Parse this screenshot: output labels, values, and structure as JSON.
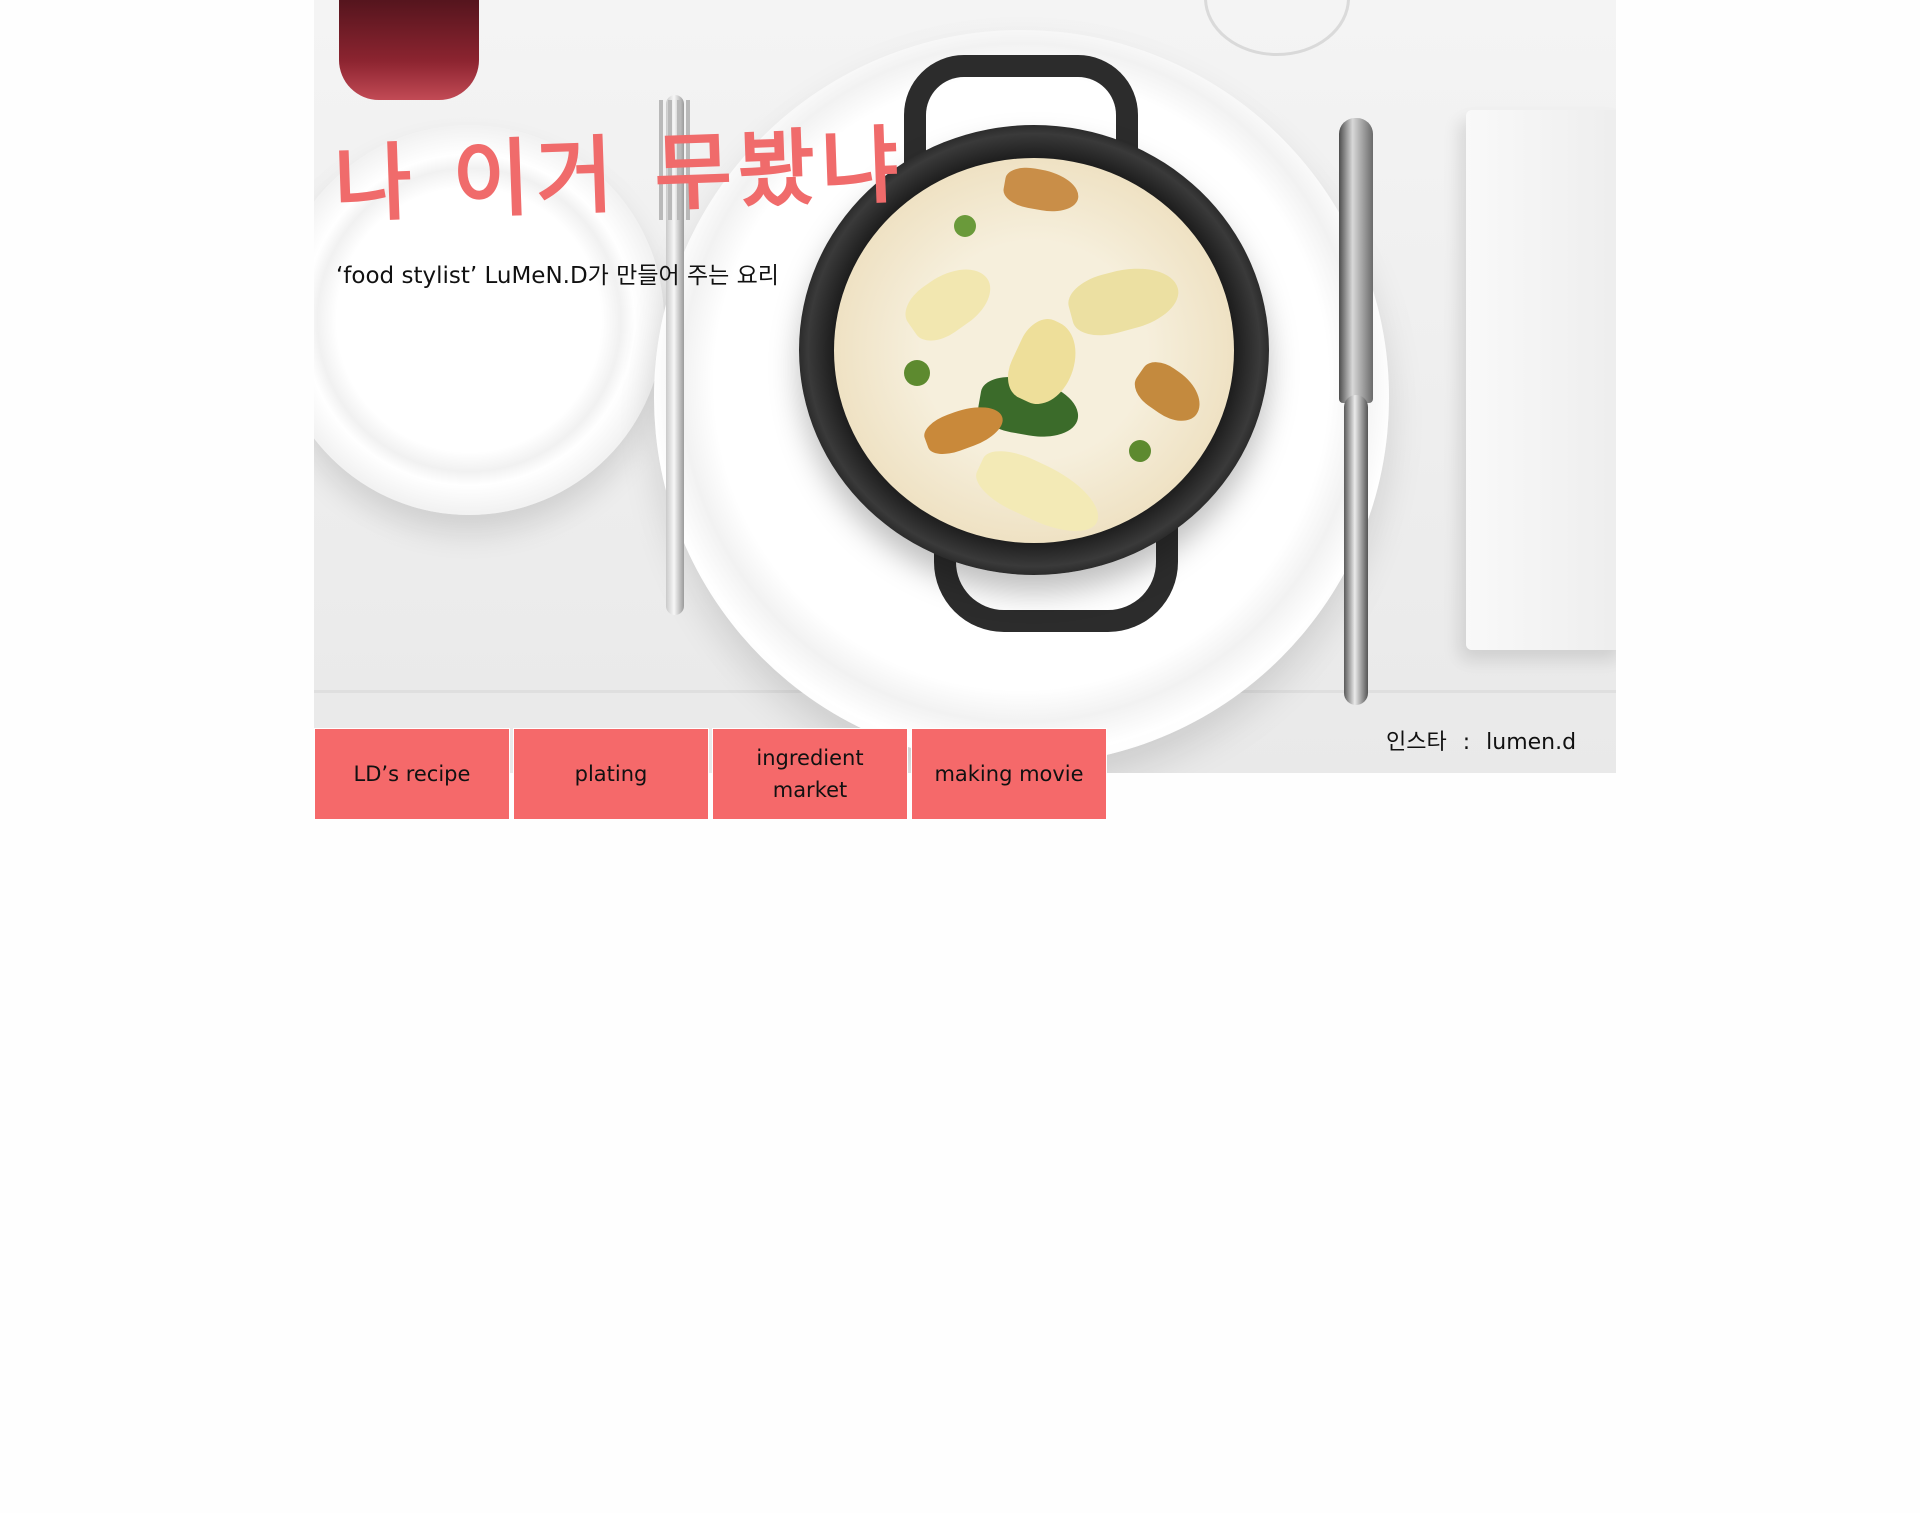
{
  "header": {
    "title": "나 이거 무봤냐",
    "subtitle": "‘food stylist’ LuMeN.D가 만들어 주는 요리",
    "instagram": {
      "label": "인스타",
      "separator": ":",
      "handle": "lumen.d"
    }
  },
  "nav": {
    "items": [
      {
        "label": "LD’s recipe"
      },
      {
        "label": "plating"
      },
      {
        "label": "ingredient market"
      },
      {
        "label": "making movie"
      }
    ]
  },
  "hero_image": {
    "icon": "food-photo-risotto"
  },
  "colors": {
    "accent": "#f5696a",
    "title": "#f06b6b",
    "text": "#111111",
    "background": "#fefefe"
  }
}
